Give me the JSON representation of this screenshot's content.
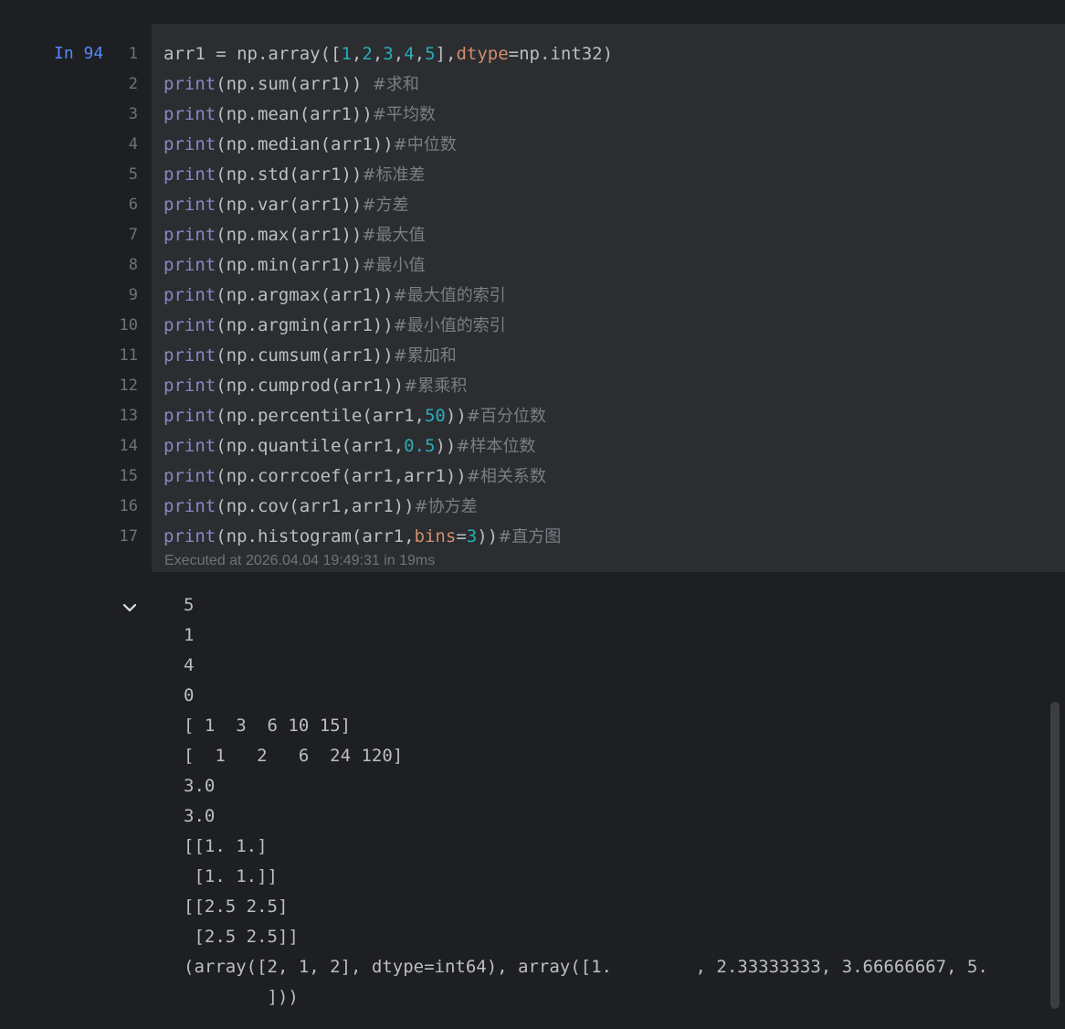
{
  "cell": {
    "prompt": "In 94",
    "line_numbers": [
      "1",
      "2",
      "3",
      "4",
      "5",
      "6",
      "7",
      "8",
      "9",
      "10",
      "11",
      "12",
      "13",
      "14",
      "15",
      "16",
      "17"
    ],
    "code_lines": [
      [
        {
          "t": "arr1 = np.array(["
        },
        {
          "t": "1",
          "k": "num"
        },
        {
          "t": ","
        },
        {
          "t": "2",
          "k": "num"
        },
        {
          "t": ","
        },
        {
          "t": "3",
          "k": "num"
        },
        {
          "t": ","
        },
        {
          "t": "4",
          "k": "num"
        },
        {
          "t": ","
        },
        {
          "t": "5",
          "k": "num"
        },
        {
          "t": "],"
        },
        {
          "t": "dtype",
          "k": "param"
        },
        {
          "t": "=np.int32)"
        }
      ],
      [
        {
          "t": "print",
          "k": "kw"
        },
        {
          "t": "(np.sum(arr1)) "
        },
        {
          "t": "#求和",
          "k": "com"
        }
      ],
      [
        {
          "t": "print",
          "k": "kw"
        },
        {
          "t": "(np.mean(arr1))"
        },
        {
          "t": "#平均数",
          "k": "com"
        }
      ],
      [
        {
          "t": "print",
          "k": "kw"
        },
        {
          "t": "(np.median(arr1))"
        },
        {
          "t": "#中位数",
          "k": "com"
        }
      ],
      [
        {
          "t": "print",
          "k": "kw"
        },
        {
          "t": "(np.std(arr1))"
        },
        {
          "t": "#标准差",
          "k": "com"
        }
      ],
      [
        {
          "t": "print",
          "k": "kw"
        },
        {
          "t": "(np.var(arr1))"
        },
        {
          "t": "#方差",
          "k": "com"
        }
      ],
      [
        {
          "t": "print",
          "k": "kw"
        },
        {
          "t": "(np.max(arr1))"
        },
        {
          "t": "#最大值",
          "k": "com"
        }
      ],
      [
        {
          "t": "print",
          "k": "kw"
        },
        {
          "t": "(np.min(arr1))"
        },
        {
          "t": "#最小值",
          "k": "com"
        }
      ],
      [
        {
          "t": "print",
          "k": "kw"
        },
        {
          "t": "(np.argmax(arr1))"
        },
        {
          "t": "#最大值的索引",
          "k": "com"
        }
      ],
      [
        {
          "t": "print",
          "k": "kw"
        },
        {
          "t": "(np.argmin(arr1))"
        },
        {
          "t": "#最小值的索引",
          "k": "com"
        }
      ],
      [
        {
          "t": "print",
          "k": "kw"
        },
        {
          "t": "(np.cumsum(arr1))"
        },
        {
          "t": "#累加和",
          "k": "com"
        }
      ],
      [
        {
          "t": "print",
          "k": "kw"
        },
        {
          "t": "(np.cumprod(arr1))"
        },
        {
          "t": "#累乘积",
          "k": "com"
        }
      ],
      [
        {
          "t": "print",
          "k": "kw"
        },
        {
          "t": "(np.percentile(arr1,"
        },
        {
          "t": "50",
          "k": "num"
        },
        {
          "t": "))"
        },
        {
          "t": "#百分位数",
          "k": "com"
        }
      ],
      [
        {
          "t": "print",
          "k": "kw"
        },
        {
          "t": "(np.quantile(arr1,"
        },
        {
          "t": "0.5",
          "k": "num"
        },
        {
          "t": "))"
        },
        {
          "t": "#样本位数",
          "k": "com"
        }
      ],
      [
        {
          "t": "print",
          "k": "kw"
        },
        {
          "t": "(np.corrcoef(arr1,arr1))"
        },
        {
          "t": "#相关系数",
          "k": "com"
        }
      ],
      [
        {
          "t": "print",
          "k": "kw"
        },
        {
          "t": "(np.cov(arr1,arr1))"
        },
        {
          "t": "#协方差",
          "k": "com"
        }
      ],
      [
        {
          "t": "print",
          "k": "kw"
        },
        {
          "t": "(np.histogram(arr1,"
        },
        {
          "t": "bins",
          "k": "param"
        },
        {
          "t": "="
        },
        {
          "t": "3",
          "k": "num"
        },
        {
          "t": "))"
        },
        {
          "t": "#直方图",
          "k": "com"
        }
      ]
    ],
    "exec_status": "Executed at 2026.04.04 19:49:31 in 19ms"
  },
  "output": {
    "toggle_icon": "chevron-down-icon",
    "lines": [
      "5",
      "1",
      "4",
      "0",
      "[ 1  3  6 10 15]",
      "[  1   2   6  24 120]",
      "3.0",
      "3.0",
      "[[1. 1.]",
      " [1. 1.]]",
      "[[2.5 2.5]",
      " [2.5 2.5]]",
      "(array([2, 1, 2], dtype=int64), array([1.        , 2.33333333, 3.66666667, 5.",
      "        ]))"
    ]
  },
  "colors": {
    "background": "#1e1f22",
    "cell_background": "#2b2d30",
    "prompt": "#548af7",
    "keyword": "#8888c6",
    "number": "#2aacb8",
    "parameter": "#cf8e6d",
    "comment": "#7a7e85",
    "text": "#bcbec4"
  }
}
